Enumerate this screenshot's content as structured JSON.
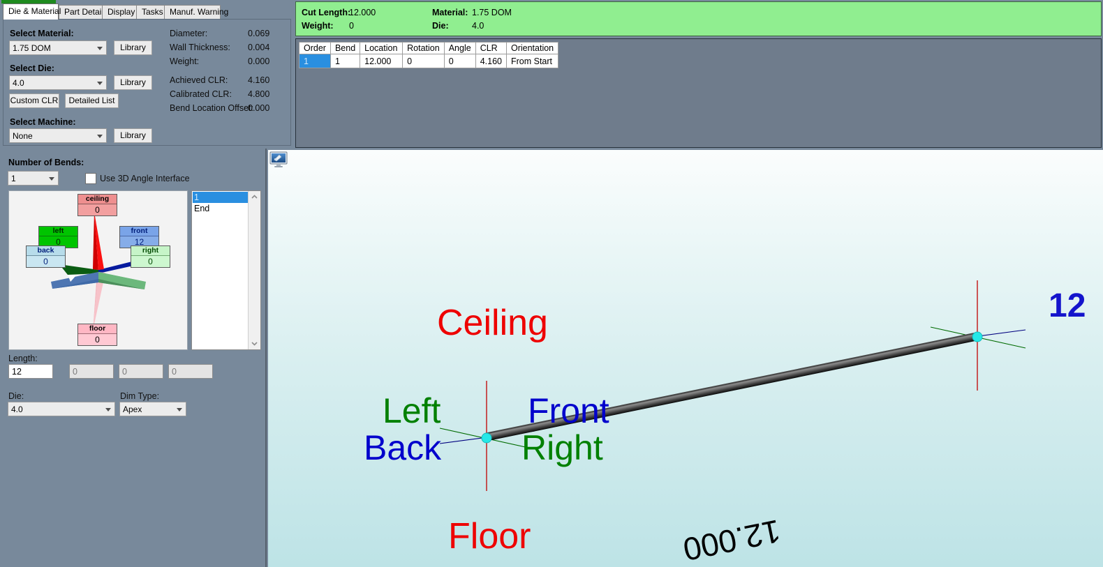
{
  "tabs": [
    {
      "label": "Die & Material",
      "active": true
    },
    {
      "label": "Part Details",
      "active": false
    },
    {
      "label": "Display",
      "active": false
    },
    {
      "label": "Tasks",
      "active": false
    },
    {
      "label": "Manuf. Warning",
      "active": false
    }
  ],
  "die_material": {
    "material_label": "Select Material:",
    "material_value": "1.75 DOM",
    "material_library_btn": "Library",
    "die_label": "Select Die:",
    "die_value": "4.0",
    "die_library_btn": "Library",
    "custom_clr_btn": "Custom CLR",
    "detailed_list_btn": "Detailed List",
    "machine_label": "Select Machine:",
    "machine_value": "None",
    "machine_library_btn": "Library",
    "info": [
      {
        "label": "Diameter:",
        "value": "0.069"
      },
      {
        "label": "Wall Thickness:",
        "value": "0.004"
      },
      {
        "label": "Weight:",
        "value": "0.000"
      },
      {
        "label": "Achieved CLR:",
        "value": "4.160"
      },
      {
        "label": "Calibrated CLR:",
        "value": "4.800"
      },
      {
        "label": "Bend Location Offset:",
        "value": "0.000"
      }
    ]
  },
  "summary": {
    "cut_length_label": "Cut Length:",
    "cut_length_value": "12.000",
    "weight_label": "Weight:",
    "weight_value": "0",
    "material_label": "Material:",
    "material_value": "1.75 DOM",
    "die_label": "Die:",
    "die_value": "4.0"
  },
  "bend_table": {
    "columns": [
      "Order",
      "Bend",
      "Location",
      "Rotation",
      "Angle",
      "CLR",
      "Orientation"
    ],
    "rows": [
      {
        "order": "1",
        "bend": "1",
        "location": "12.000",
        "rotation": "0",
        "angle": "0",
        "clr": "4.160",
        "orientation": "From Start"
      }
    ]
  },
  "bends_panel": {
    "num_bends_label": "Number of Bends:",
    "num_bends_value": "1",
    "use_3d_checkbox_label": "Use 3D Angle Interface",
    "use_3d_checked": false,
    "star": {
      "ceiling": {
        "name": "ceiling",
        "value": "0"
      },
      "floor": {
        "name": "floor",
        "value": "0"
      },
      "left": {
        "name": "left",
        "value": "0"
      },
      "right": {
        "name": "right",
        "value": "0"
      },
      "front": {
        "name": "front",
        "value": "12"
      },
      "back": {
        "name": "back",
        "value": "0"
      }
    },
    "bend_list": [
      "1",
      "End"
    ],
    "bend_list_selected": 0,
    "length_label": "Length:",
    "length_values": [
      "12",
      "0",
      "0",
      "0"
    ],
    "die_label": "Die:",
    "die_value": "4.0",
    "dim_type_label": "Dim Type:",
    "dim_type_value": "Apex"
  },
  "viewport": {
    "axis_labels": [
      {
        "text": "Ceiling",
        "color": "#ee0000"
      },
      {
        "text": "Floor",
        "color": "#ee0000"
      },
      {
        "text": "Left",
        "color": "#008000"
      },
      {
        "text": "Right",
        "color": "#008000"
      },
      {
        "text": "Front",
        "color": "#0000cc"
      },
      {
        "text": "Back",
        "color": "#0000cc"
      }
    ],
    "segment_length_label": "12",
    "tube_dimension_label": "12.000",
    "screen_icon": "monitor-icon"
  },
  "colors": {
    "panel_bg": "#78899b",
    "summary_green": "#90ee90",
    "select_blue": "#2a8fe0",
    "ceiling": "#ee0000",
    "floor": "#ee0000",
    "axis_left_right": "#008000",
    "axis_front_back": "#0000cc",
    "node_cyan": "#25e8e8"
  }
}
